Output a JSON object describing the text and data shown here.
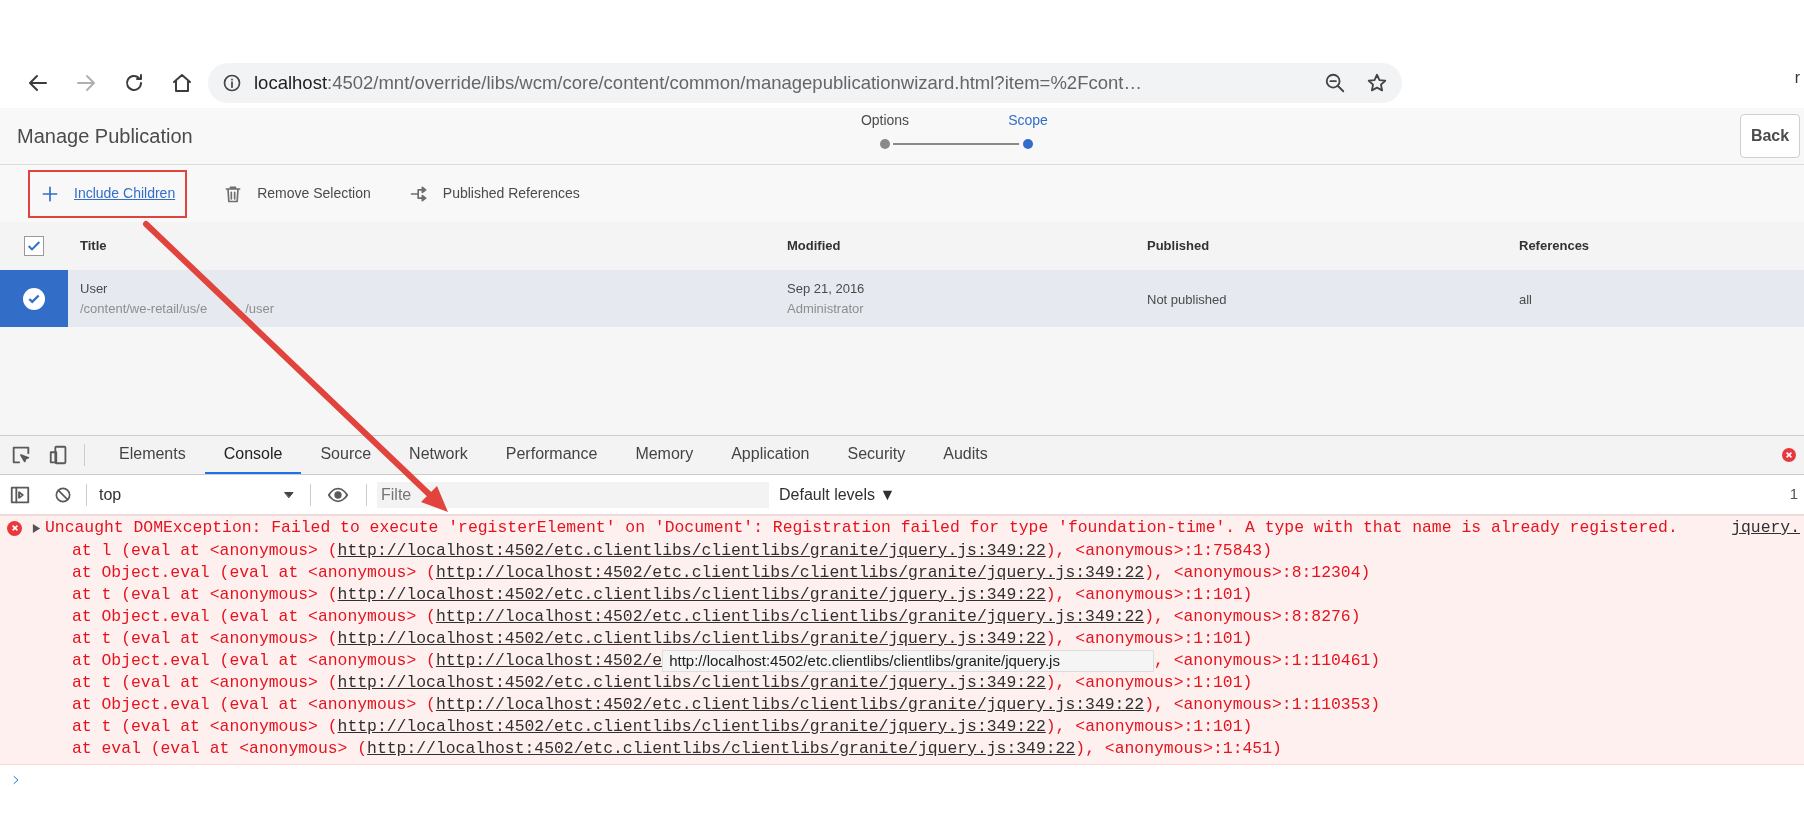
{
  "browser": {
    "nav": [
      {
        "kind": "back",
        "disabled": false
      },
      {
        "kind": "forward",
        "disabled": true
      },
      {
        "kind": "reload",
        "disabled": false
      },
      {
        "kind": "home",
        "disabled": false
      }
    ],
    "url_host": "localhost",
    "url_rest": ":4502/mnt/override/libs/wcm/core/content/common/managepublicationwizard.html?item=%2Fcont…",
    "edge_text": "r"
  },
  "app": {
    "title": "Manage Publication",
    "steps": [
      {
        "label": "Options",
        "selected": false
      },
      {
        "label": "Scope",
        "selected": true
      }
    ],
    "back_button": "Back"
  },
  "toolbar": [
    {
      "kind": "add",
      "label": "Include Children",
      "hovered": true,
      "highlighted": true
    },
    {
      "kind": "remove",
      "label": "Remove Selection",
      "hovered": false,
      "highlighted": false
    },
    {
      "kind": "references",
      "label": "Published References",
      "hovered": false,
      "highlighted": false
    }
  ],
  "table": {
    "select_all_checked": true,
    "columns": [
      "Title",
      "Modified",
      "Published",
      "References"
    ],
    "rows": [
      {
        "selected": true,
        "title": "User",
        "path": "/content/we-retail/us/e",
        "path_tail": "/user",
        "modified": "Sep 21, 2016",
        "modified_by": "Administrator",
        "published": "Not published",
        "references": "all"
      }
    ]
  },
  "devtools": {
    "tabs": [
      {
        "label": "Elements",
        "selected": false
      },
      {
        "label": "Console",
        "selected": true
      },
      {
        "label": "Source",
        "selected": false
      },
      {
        "label": "Network",
        "selected": false
      },
      {
        "label": "Performance",
        "selected": false
      },
      {
        "label": "Memory",
        "selected": false
      },
      {
        "label": "Application",
        "selected": false
      },
      {
        "label": "Security",
        "selected": false
      },
      {
        "label": "Audits",
        "selected": false
      }
    ],
    "context": "top",
    "filter_placeholder": "Filte",
    "levels": "Default levels ▼",
    "edge_count": "1",
    "messages": [
      {
        "kind": "error",
        "expanded": false,
        "text": "Uncaught DOMException: Failed to execute 'registerElement' on 'Document': Registration failed for type 'foundation-time'. A type with that name is already registered.",
        "source": "jquery.",
        "stack": [
          {
            "prefix": "at l (eval at <anonymous> (",
            "link": "http://localhost:4502/etc.clientlibs/clientlibs/granite/jquery.js:349:22",
            "suffix": "), <anonymous>:1:75843)"
          },
          {
            "prefix": "at Object.eval (eval at <anonymous> (",
            "link": "http://localhost:4502/etc.clientlibs/clientlibs/granite/jquery.js:349:22",
            "suffix": "), <anonymous>:8:12304)"
          },
          {
            "prefix": "at t (eval at <anonymous> (",
            "link": "http://localhost:4502/etc.clientlibs/clientlibs/granite/jquery.js:349:22",
            "suffix": "), <anonymous>:1:101)"
          },
          {
            "prefix": "at Object.eval (eval at <anonymous> (",
            "link": "http://localhost:4502/etc.clientlibs/clientlibs/granite/jquery.js:349:22",
            "suffix": "), <anonymous>:8:8276)"
          },
          {
            "prefix": "at t (eval at <anonymous> (",
            "link": "http://localhost:4502/etc.clientlibs/clientlibs/granite/jquery.js:349:22",
            "suffix": "), <anonymous>:1:101)"
          },
          {
            "prefix": "at Object.eval (eval at <anonymous> (",
            "link": "http://localhost:4502/e",
            "suffix": ", <anonymous>:1:110461)",
            "tooltip": "http://localhost:4502/etc.clientlibs/clientlibs/granite/jquery.js"
          },
          {
            "prefix": "at t (eval at <anonymous> (",
            "link": "http://localhost:4502/etc.clientlibs/clientlibs/granite/jquery.js:349:22",
            "suffix": "), <anonymous>:1:101)"
          },
          {
            "prefix": "at Object.eval (eval at <anonymous> (",
            "link": "http://localhost:4502/etc.clientlibs/clientlibs/granite/jquery.js:349:22",
            "suffix": "), <anonymous>:1:110353)"
          },
          {
            "prefix": "at t (eval at <anonymous> (",
            "link": "http://localhost:4502/etc.clientlibs/clientlibs/granite/jquery.js:349:22",
            "suffix": "), <anonymous>:1:101)"
          },
          {
            "prefix": "at eval (eval at <anonymous> (",
            "link": "http://localhost:4502/etc.clientlibs/clientlibs/granite/jquery.js:349:22",
            "suffix": "), <anonymous>:1:451)"
          }
        ]
      }
    ]
  }
}
